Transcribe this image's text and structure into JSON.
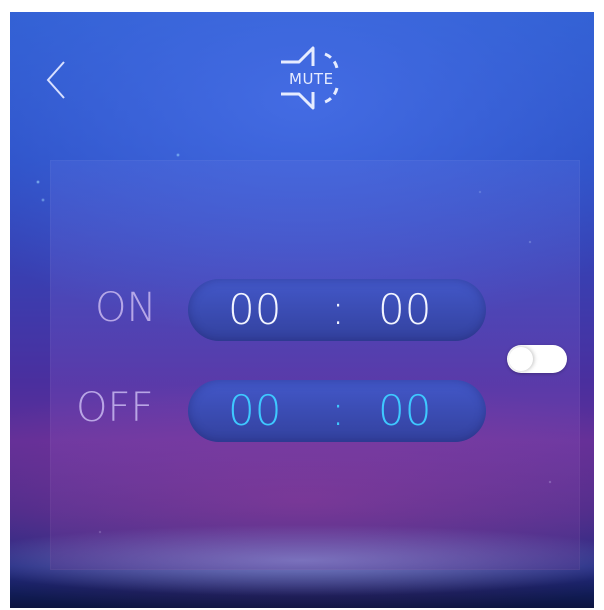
{
  "header": {
    "back_icon": "chevron-left-icon",
    "mute_icon": "speaker-mute-icon",
    "mute_label": "MUTE"
  },
  "schedule": {
    "on": {
      "label": "ON",
      "hour": "00",
      "separator": ":",
      "minute": "00"
    },
    "off": {
      "label": "OFF",
      "hour": "00",
      "separator": ":",
      "minute": "00"
    }
  },
  "toggle": {
    "state": "off"
  },
  "colors": {
    "on_time_text": "#f2f4ff",
    "off_time_text": "#3ec9ff",
    "label_text": "#c8b8f0",
    "pill_bg": "#3d4fb8"
  }
}
